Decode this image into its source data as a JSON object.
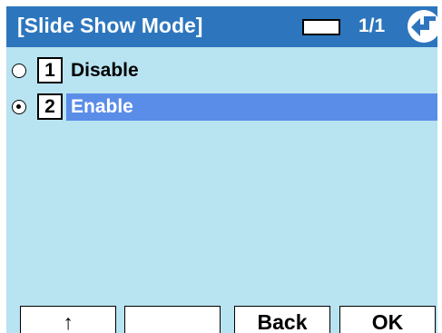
{
  "header": {
    "title": "[Slide Show Mode]",
    "page_indicator": "1/1",
    "back_icon": "back-arrow-icon"
  },
  "menu": {
    "items": [
      {
        "number": "1",
        "label": "Disable",
        "selected": false
      },
      {
        "number": "2",
        "label": "Enable",
        "selected": true
      }
    ]
  },
  "softkeys": {
    "key1": "↑",
    "key2": "",
    "key3": "Back",
    "key4": "OK"
  },
  "colors": {
    "header_bg": "#2d76be",
    "screen_bg": "#b8e3f1",
    "highlight": "#5a8de8"
  }
}
